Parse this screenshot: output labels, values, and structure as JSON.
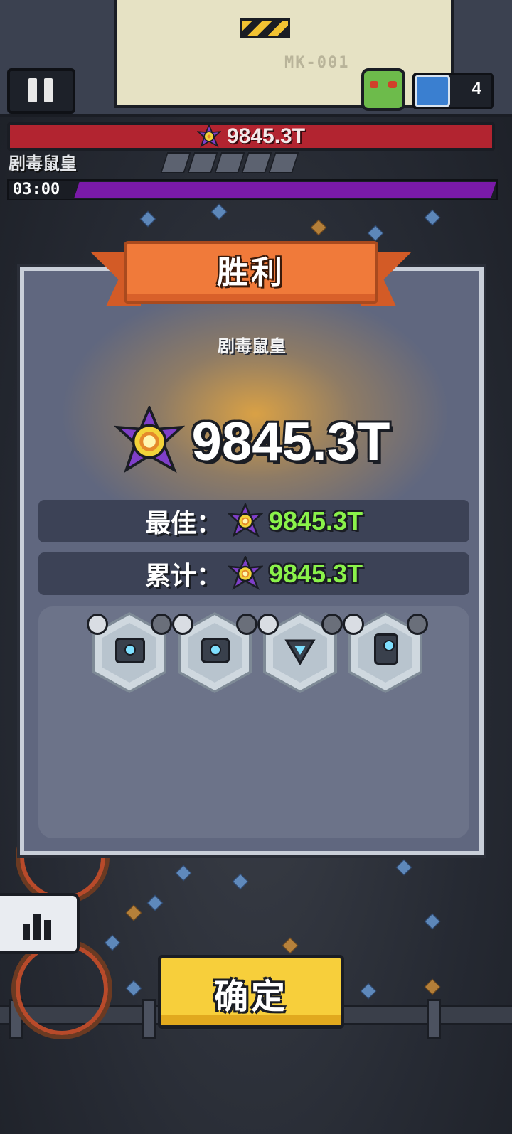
{
  "hud": {
    "building_code": "MK-001",
    "item_count": "4",
    "boss_hp": "9845.3T",
    "boss_name": "剧毒鼠皇",
    "timer": "03:00"
  },
  "result": {
    "title": "胜利",
    "boss_name": "剧毒鼠皇",
    "damage": "9845.3T",
    "best_label": "最佳：",
    "best_value": "9845.3T",
    "total_label": "累计：",
    "total_value": "9845.3T"
  },
  "equipment": [
    {
      "icon": "laser-turret-icon"
    },
    {
      "icon": "camera-turret-icon"
    },
    {
      "icon": "triangle-emitter-icon"
    },
    {
      "icon": "battery-device-icon"
    }
  ],
  "confirm_button": "确定",
  "colors": {
    "panel": "#60677f",
    "banner": "#f07a3a",
    "value_green": "#8af24a",
    "confirm": "#f7cf3b",
    "hp_bar": "#b22430",
    "timer_bar": "#7a1aa8"
  }
}
